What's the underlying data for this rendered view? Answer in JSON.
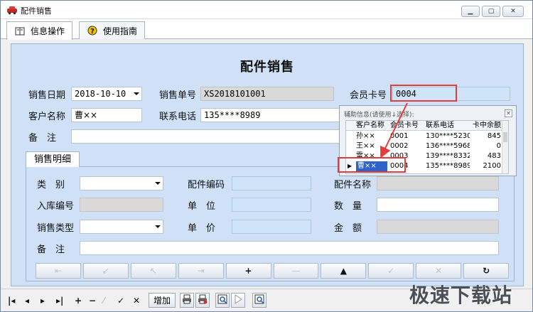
{
  "window": {
    "title": "配件销售"
  },
  "tabs": [
    {
      "label": "信息操作",
      "icon": "info-book-icon"
    },
    {
      "label": "使用指南",
      "icon": "help-icon"
    }
  ],
  "form": {
    "title": "配件销售",
    "sale_date_label": "销售日期",
    "sale_date_value": "2018-10-10",
    "sale_no_label": "销售单号",
    "sale_no_value": "XS2018101001",
    "member_card_label": "会员卡号",
    "member_card_value": "0004",
    "customer_label": "客户名称",
    "customer_value": "曹××",
    "phone_label": "联系电话",
    "phone_value": "135****8989",
    "remark_label": "备　注",
    "remark_value": ""
  },
  "detail": {
    "section_label": "销售明细",
    "category_label": "类　别",
    "part_code_label": "配件编码",
    "part_name_label": "配件名称",
    "stock_no_label": "入库编号",
    "unit_label": "单　位",
    "quantity_label": "数　量",
    "sale_type_label": "销售类型",
    "price_label": "单　价",
    "amount_label": "金　额",
    "remark_label": "备　注"
  },
  "nav_buttons": [
    {
      "glyph": "⇤",
      "enabled": false
    },
    {
      "glyph": "↙",
      "enabled": false
    },
    {
      "glyph": "↖",
      "enabled": false
    },
    {
      "glyph": "⇥",
      "enabled": false
    },
    {
      "glyph": "+",
      "enabled": true
    },
    {
      "glyph": "—",
      "enabled": false
    },
    {
      "glyph": "▲",
      "enabled": true
    },
    {
      "glyph": "✓",
      "enabled": false
    },
    {
      "glyph": "✕",
      "enabled": false
    },
    {
      "glyph": "↻",
      "enabled": true
    }
  ],
  "popup": {
    "title": "辅助信息(请使用↓选择):",
    "columns": [
      "客户名称",
      "会员卡号",
      "联系电话",
      "卡中余额"
    ],
    "rows": [
      {
        "name": "孙××",
        "card": "0001",
        "phone": "130****5230",
        "balance": "845"
      },
      {
        "name": "王××",
        "card": "0002",
        "phone": "136****5968",
        "balance": "0"
      },
      {
        "name": "雷××",
        "card": "0003",
        "phone": "139****8332",
        "balance": "483"
      },
      {
        "name": "曹××",
        "card": "0004",
        "phone": "135****8989",
        "balance": "2100",
        "selected": true
      }
    ]
  },
  "toolbar": {
    "add_label": "增加",
    "nav_glyphs": [
      "|◂",
      "◂",
      "▸",
      "▸|",
      "+",
      "−",
      "⁄",
      "✓",
      "✕"
    ]
  },
  "watermark": "极速下载站",
  "colors": {
    "form_bg": "#cfe0f7",
    "highlight_red": "#e23c3c",
    "selection_blue": "#2f63c9"
  }
}
